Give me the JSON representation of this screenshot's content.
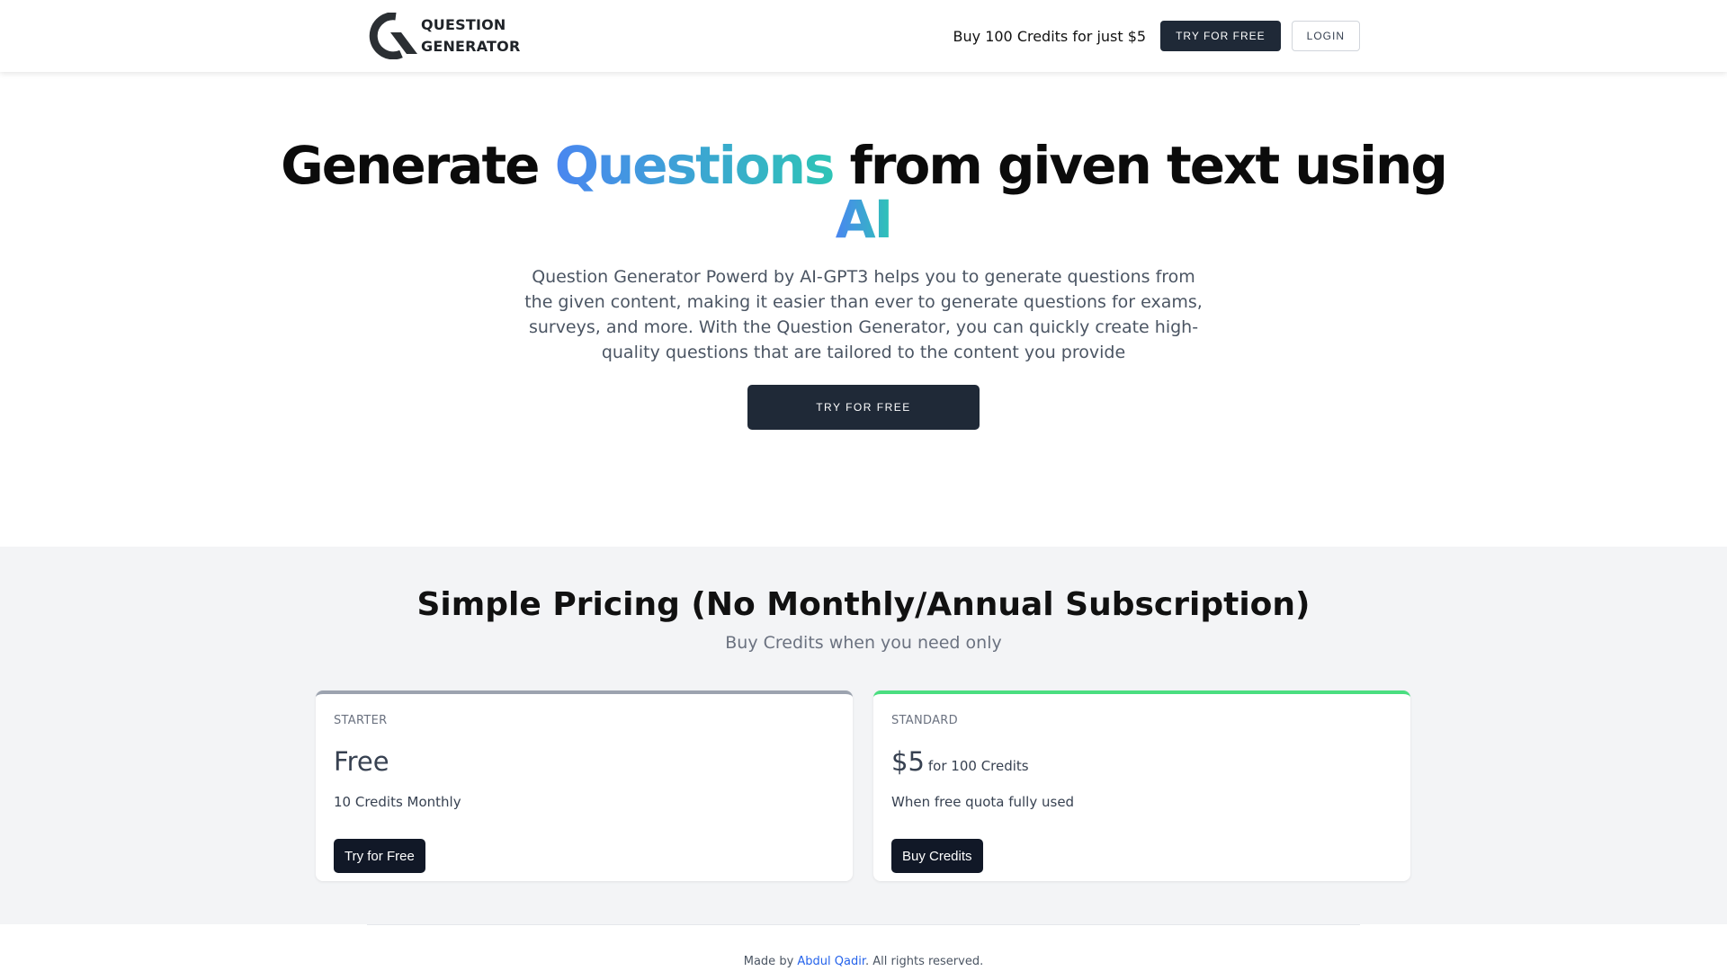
{
  "header": {
    "logo_line1": "QUESTION",
    "logo_line2": "GENERATOR",
    "promo": "Buy 100 Credits for just $5",
    "try_label": "TRY FOR FREE",
    "login_label": "LOGIN"
  },
  "hero": {
    "title_part1": "Generate ",
    "title_highlight1": "Questions",
    "title_part2": " from given text using",
    "title_highlight2": "AI",
    "description": "Question Generator Powerd by AI-GPT3 helps you to generate questions from the given content, making it easier than ever to generate questions for exams, surveys, and more. With the Question Generator, you can quickly create high-quality questions that are tailored to the content you provide",
    "cta_label": "TRY FOR FREE"
  },
  "pricing": {
    "title": "Simple Pricing (No Monthly/Annual Subscription)",
    "subtitle": "Buy Credits when you need only",
    "plans": [
      {
        "tier": "STARTER",
        "price": "Free",
        "per": "",
        "description": "10 Credits Monthly",
        "button": "Try for Free",
        "accent": "#9ca3af"
      },
      {
        "tier": "STANDARD",
        "price": "$5",
        "per": "for 100 Credits",
        "description": "When free quota fully used",
        "button": "Buy Credits",
        "accent": "#4ade80"
      }
    ]
  },
  "footer": {
    "prefix": "Made by ",
    "author": "Abdul Qadir",
    "suffix": ". All rights reserved."
  },
  "colors": {
    "primary_dark": "#1f2937",
    "gradient_start": "#4a86f0",
    "gradient_end": "#2ec4b6",
    "link": "#2563eb"
  }
}
